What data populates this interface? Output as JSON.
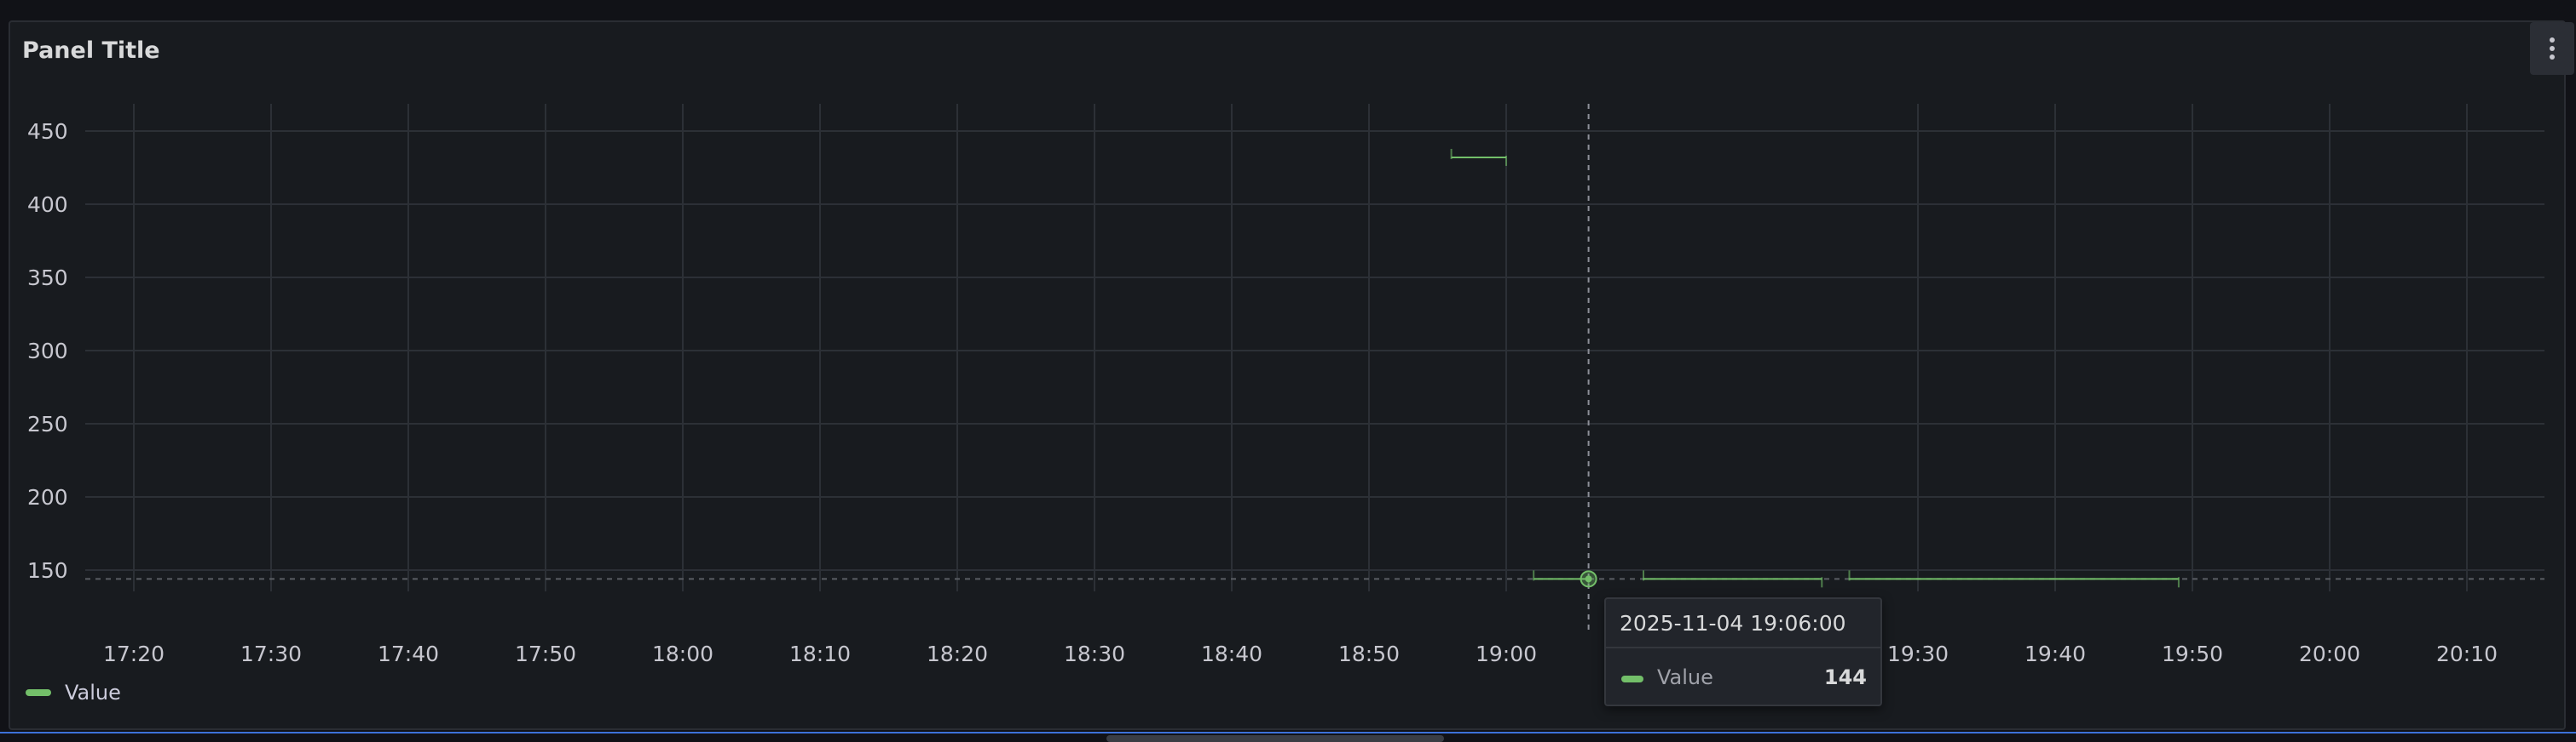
{
  "panel": {
    "title": "Panel Title",
    "menu_icon": "vertical-ellipsis-icon"
  },
  "colors": {
    "series": "#73bf69",
    "background": "#181b1f",
    "grid": "#2c3036"
  },
  "chart_data": {
    "type": "line",
    "x_tick_labels": [
      "17:20",
      "17:30",
      "17:40",
      "17:50",
      "18:00",
      "18:10",
      "18:20",
      "18:30",
      "18:40",
      "18:50",
      "19:00",
      "19:30",
      "19:40",
      "19:50",
      "20:00",
      "20:10"
    ],
    "y_tick_labels": [
      "150",
      "200",
      "250",
      "300",
      "350",
      "400",
      "450"
    ],
    "ylim": [
      125,
      465
    ],
    "xlim": [
      "17:17",
      "20:15"
    ],
    "grid": true,
    "threshold_line": 144,
    "legend_position": "bottom-left",
    "series": [
      {
        "name": "Value",
        "segments": [
          {
            "x": [
              "18:56",
              "19:00"
            ],
            "values": [
              432,
              432
            ]
          },
          {
            "x": [
              "19:02",
              "19:06"
            ],
            "values": [
              144,
              144
            ]
          },
          {
            "x": [
              "19:10",
              "19:23"
            ],
            "values": [
              144,
              144
            ]
          },
          {
            "x": [
              "19:25",
              "19:49"
            ],
            "values": [
              144,
              144
            ]
          }
        ]
      }
    ],
    "hover": {
      "x": "19:06",
      "value": 144
    }
  },
  "tooltip": {
    "time": "2025-11-04 19:06:00",
    "series_name": "Value",
    "value": "144"
  },
  "legend": {
    "items": [
      {
        "name": "Value"
      }
    ]
  }
}
